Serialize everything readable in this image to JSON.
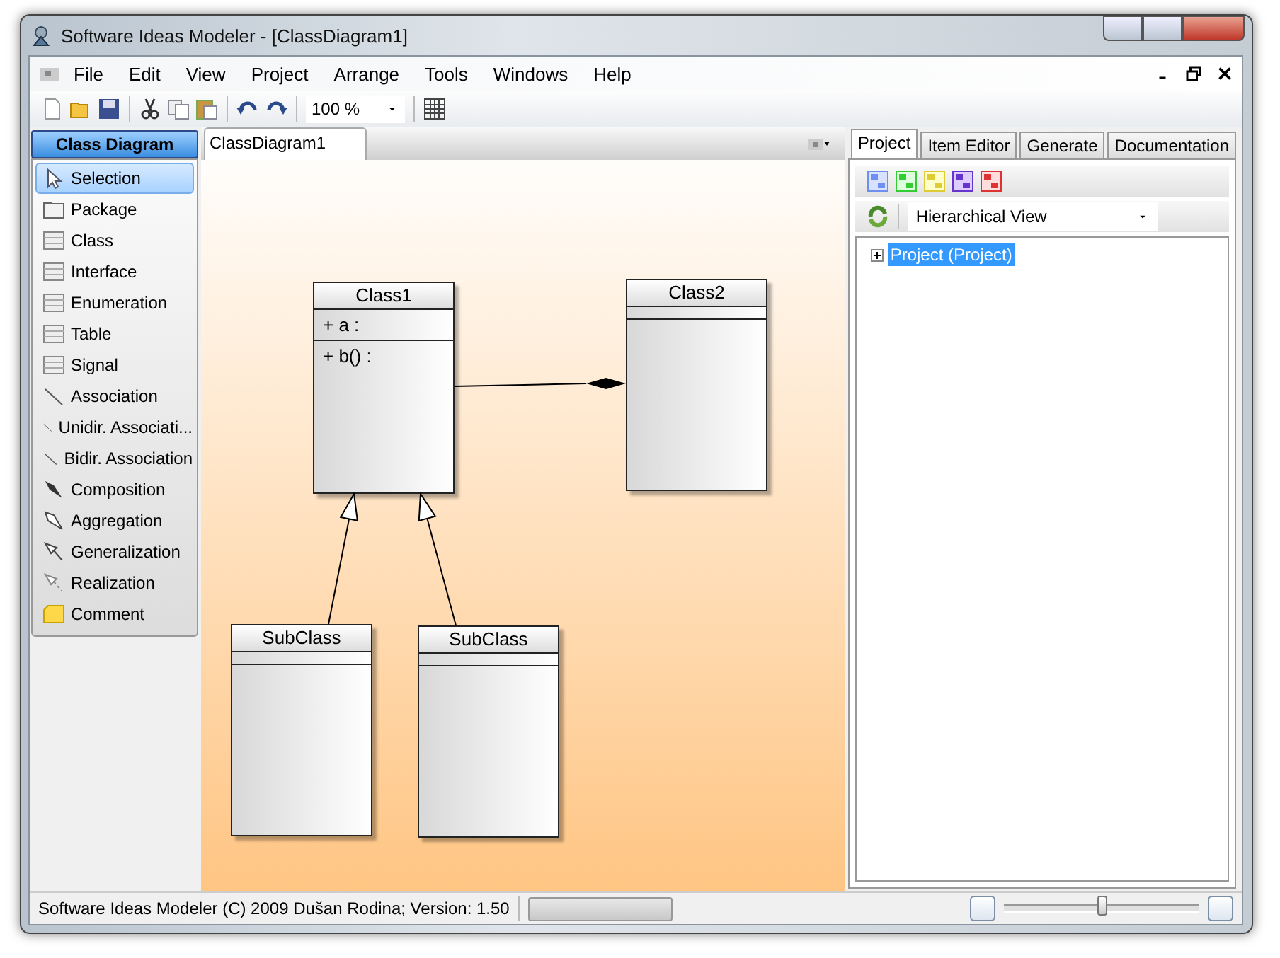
{
  "window": {
    "title": "Software Ideas Modeler - [ClassDiagram1]"
  },
  "menu": [
    "File",
    "Edit",
    "View",
    "Project",
    "Arrange",
    "Tools",
    "Windows",
    "Help"
  ],
  "toolbar": {
    "zoom": "100 %"
  },
  "toolbox": {
    "title": "Class Diagram",
    "items": [
      {
        "label": "Selection",
        "kind": "pointer",
        "selected": true
      },
      {
        "label": "Package",
        "kind": "package",
        "selected": false
      },
      {
        "label": "Class",
        "kind": "class",
        "selected": false
      },
      {
        "label": "Interface",
        "kind": "class",
        "selected": false
      },
      {
        "label": "Enumeration",
        "kind": "class",
        "selected": false
      },
      {
        "label": "Table",
        "kind": "class",
        "selected": false
      },
      {
        "label": "Signal",
        "kind": "class",
        "selected": false
      },
      {
        "label": "Association",
        "kind": "line",
        "selected": false
      },
      {
        "label": "Unidir. Associati...",
        "kind": "line",
        "selected": false
      },
      {
        "label": "Bidir. Association",
        "kind": "line",
        "selected": false
      },
      {
        "label": "Composition",
        "kind": "composition",
        "selected": false
      },
      {
        "label": "Aggregation",
        "kind": "aggregation",
        "selected": false
      },
      {
        "label": "Generalization",
        "kind": "generalization",
        "selected": false
      },
      {
        "label": "Realization",
        "kind": "realization",
        "selected": false
      },
      {
        "label": "Comment",
        "kind": "comment",
        "selected": false
      }
    ]
  },
  "document_tab": "ClassDiagram1",
  "diagram": {
    "classes": [
      {
        "name": "Class1",
        "attributes": [
          "+ a :"
        ],
        "operations": [
          "+ b() :"
        ]
      },
      {
        "name": "Class2"
      },
      {
        "name": "SubClass"
      },
      {
        "name": "SubClass"
      }
    ],
    "connectors": [
      {
        "kind": "composition"
      },
      {
        "kind": "generalization"
      },
      {
        "kind": "generalization"
      }
    ]
  },
  "right_panel": {
    "tabs": [
      {
        "label": "Project",
        "selected": true
      },
      {
        "label": "Item Editor",
        "selected": false
      },
      {
        "label": "Generate",
        "selected": false
      },
      {
        "label": "Documentation",
        "selected": false
      }
    ],
    "view": "Hierarchical View",
    "tree": [
      {
        "label": "Project (Project)",
        "selected": true,
        "expanded": false
      }
    ]
  },
  "status_bar": {
    "text": "Software Ideas Modeler (C) 2009 Dušan Rodina; Version: 1.50",
    "progress": {
      "level": 0
    },
    "zoom_slider": {
      "level": 0.5
    }
  }
}
